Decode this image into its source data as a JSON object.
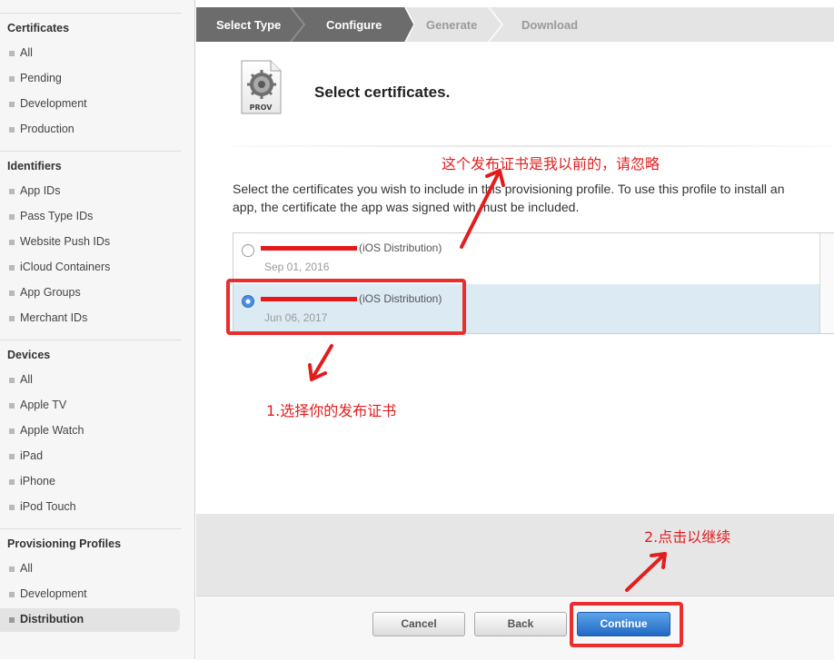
{
  "sidebar": {
    "certificates": {
      "heading": "Certificates",
      "items": [
        "All",
        "Pending",
        "Development",
        "Production"
      ]
    },
    "identifiers": {
      "heading": "Identifiers",
      "items": [
        "App IDs",
        "Pass Type IDs",
        "Website Push IDs",
        "iCloud Containers",
        "App Groups",
        "Merchant IDs"
      ]
    },
    "devices": {
      "heading": "Devices",
      "items": [
        "All",
        "Apple TV",
        "Apple Watch",
        "iPad",
        "iPhone",
        "iPod Touch"
      ]
    },
    "profiles": {
      "heading": "Provisioning Profiles",
      "items": [
        "All",
        "Development",
        "Distribution"
      ],
      "active": "Distribution"
    }
  },
  "steps": [
    "Select Type",
    "Configure",
    "Generate",
    "Download"
  ],
  "main": {
    "icon_label": "PROV",
    "title": "Select certificates.",
    "description": "Select the certificates you wish to include in this provisioning profile. To use this profile to install an app, the certificate the app was signed with must be included.",
    "certificates": [
      {
        "type": "(iOS Distribution)",
        "date": "Sep 01, 2016",
        "selected": false
      },
      {
        "type": "(iOS Distribution)",
        "date": "Jun 06, 2017",
        "selected": true
      }
    ]
  },
  "footer": {
    "cancel": "Cancel",
    "back": "Back",
    "continue": "Continue"
  },
  "annotations": {
    "ignore_note": "这个发布证书是我以前的，请忽略",
    "step1": "1.选择你的发布证书",
    "step2": "2.点击以继续"
  },
  "colors": {
    "annotation": "#e31d1d",
    "primary_button": "#2269c4",
    "selected_row": "#dceaf4"
  }
}
